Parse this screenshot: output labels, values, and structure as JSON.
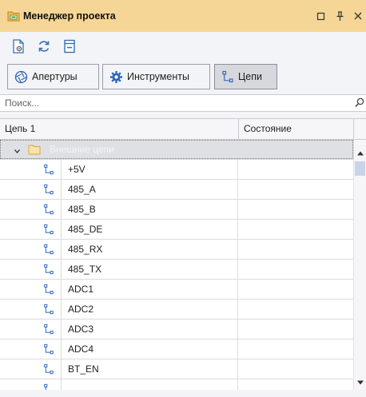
{
  "window": {
    "title": "Менеджер проекта",
    "icon": "project-folder-icon",
    "controls": {
      "restore": "□",
      "pin": "⊥",
      "close": "✕"
    }
  },
  "toolbar": {
    "icons": [
      "document-settings-icon",
      "refresh-icon",
      "collapse-icon"
    ]
  },
  "tabs": [
    {
      "label": "Апертуры",
      "icon": "aperture-icon",
      "active": false
    },
    {
      "label": "Инструменты",
      "icon": "gear-icon",
      "active": false
    },
    {
      "label": "Цепи",
      "icon": "net-icon",
      "active": true
    }
  ],
  "search": {
    "placeholder": "Поиск..."
  },
  "grid": {
    "columns": [
      "Цепь 1",
      "Состояние"
    ],
    "group": {
      "label": "Внешние цепи",
      "expanded": true
    },
    "rows": [
      {
        "name": "+5V",
        "state": ""
      },
      {
        "name": "485_A",
        "state": ""
      },
      {
        "name": "485_B",
        "state": ""
      },
      {
        "name": "485_DE",
        "state": ""
      },
      {
        "name": "485_RX",
        "state": ""
      },
      {
        "name": "485_TX",
        "state": ""
      },
      {
        "name": "ADC1",
        "state": ""
      },
      {
        "name": "ADC2",
        "state": ""
      },
      {
        "name": "ADC3",
        "state": ""
      },
      {
        "name": "ADC4",
        "state": ""
      },
      {
        "name": "BT_EN",
        "state": ""
      }
    ]
  },
  "colors": {
    "titlebar": "#f5d696",
    "active_tab": "#d6d8dd",
    "scroll_thumb": "#c8d4ea",
    "folder": "#f0c14b"
  }
}
